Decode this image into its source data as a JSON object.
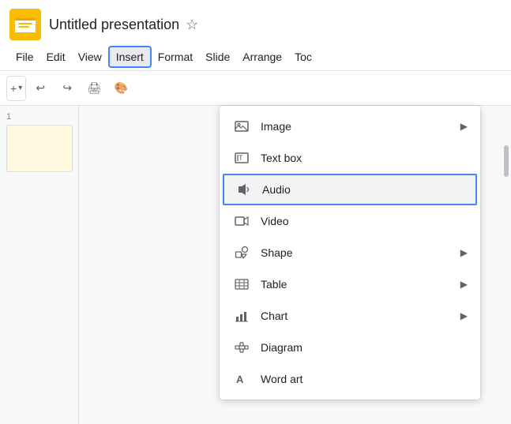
{
  "title": {
    "app_name": "Untitled presentation",
    "star_icon": "☆"
  },
  "menubar": {
    "items": [
      {
        "id": "file",
        "label": "File"
      },
      {
        "id": "edit",
        "label": "Edit"
      },
      {
        "id": "view",
        "label": "View"
      },
      {
        "id": "insert",
        "label": "Insert",
        "active": true
      },
      {
        "id": "format",
        "label": "Format"
      },
      {
        "id": "slide",
        "label": "Slide"
      },
      {
        "id": "arrange",
        "label": "Arrange"
      },
      {
        "id": "toc",
        "label": "Toc"
      }
    ]
  },
  "toolbar": {
    "add_label": "+",
    "chevron_label": "▾"
  },
  "slide_panel": {
    "slide_number": "1"
  },
  "insert_menu": {
    "items": [
      {
        "id": "image",
        "label": "Image",
        "icon": "image",
        "has_arrow": true
      },
      {
        "id": "textbox",
        "label": "Text box",
        "icon": "textbox",
        "has_arrow": false
      },
      {
        "id": "audio",
        "label": "Audio",
        "icon": "audio",
        "has_arrow": false,
        "highlighted": true
      },
      {
        "id": "video",
        "label": "Video",
        "icon": "video",
        "has_arrow": false
      },
      {
        "id": "shape",
        "label": "Shape",
        "icon": "shape",
        "has_arrow": true
      },
      {
        "id": "table",
        "label": "Table",
        "icon": "table",
        "has_arrow": true
      },
      {
        "id": "chart",
        "label": "Chart",
        "icon": "chart",
        "has_arrow": true
      },
      {
        "id": "diagram",
        "label": "Diagram",
        "icon": "diagram",
        "has_arrow": false
      },
      {
        "id": "wordart",
        "label": "Word art",
        "icon": "wordart",
        "has_arrow": false
      }
    ]
  }
}
